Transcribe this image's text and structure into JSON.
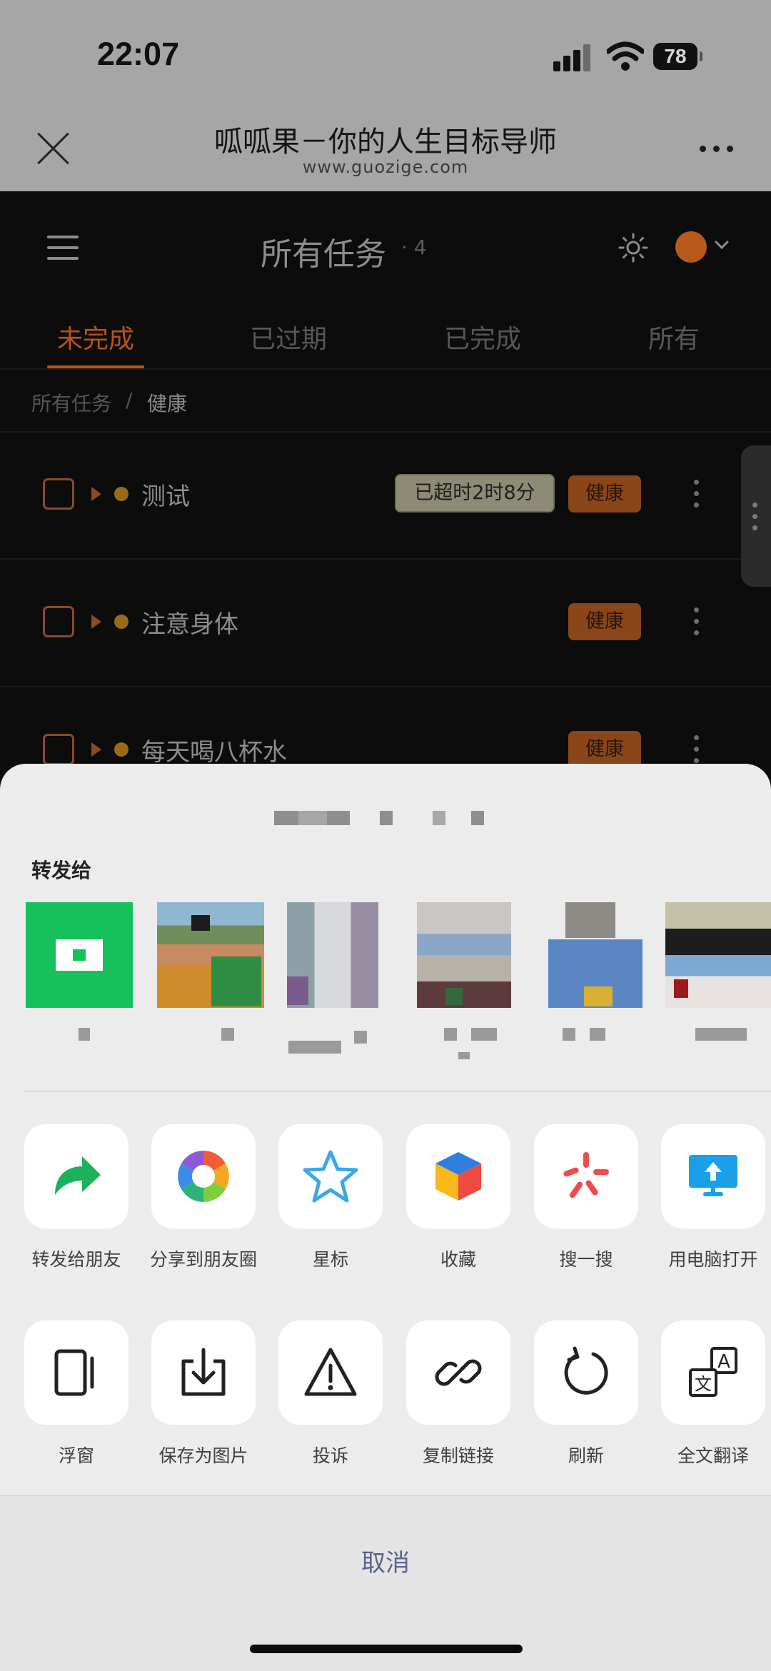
{
  "status_bar": {
    "time": "22:07",
    "battery": "78"
  },
  "webview": {
    "title": "呱呱果－你的人生目标导师",
    "url": "www.guozige.com"
  },
  "app": {
    "title": "所有任务",
    "count": "· 4",
    "tabs": [
      {
        "label": "未完成",
        "active": true
      },
      {
        "label": "已过期"
      },
      {
        "label": "已完成"
      },
      {
        "label": "所有"
      }
    ],
    "breadcrumb": {
      "root": "所有任务",
      "separator": "/",
      "current": "健康"
    },
    "tasks": [
      {
        "name": "测试",
        "overdue": "已超时2时8分",
        "tag": "健康"
      },
      {
        "name": "注意身体",
        "tag": "健康"
      },
      {
        "name": "每天喝八杯水",
        "tag": "健康"
      }
    ],
    "accent_color": "#b6531d"
  },
  "share_sheet": {
    "forward_label": "转发给",
    "actions_row1": [
      {
        "label": "转发给朋友",
        "icon": "forward-arrow-icon"
      },
      {
        "label": "分享到朋友圈",
        "icon": "moments-aperture-icon"
      },
      {
        "label": "星标",
        "icon": "star-icon"
      },
      {
        "label": "收藏",
        "icon": "favorites-cube-icon"
      },
      {
        "label": "搜一搜",
        "icon": "search-spark-icon"
      },
      {
        "label": "用电脑打开",
        "icon": "open-on-computer-icon"
      }
    ],
    "actions_row2": [
      {
        "label": "浮窗",
        "icon": "floating-window-icon"
      },
      {
        "label": "保存为图片",
        "icon": "save-image-icon"
      },
      {
        "label": "投诉",
        "icon": "warning-icon"
      },
      {
        "label": "复制链接",
        "icon": "link-icon"
      },
      {
        "label": "刷新",
        "icon": "refresh-icon"
      },
      {
        "label": "全文翻译",
        "icon": "translate-icon"
      }
    ],
    "cancel_label": "取消"
  }
}
